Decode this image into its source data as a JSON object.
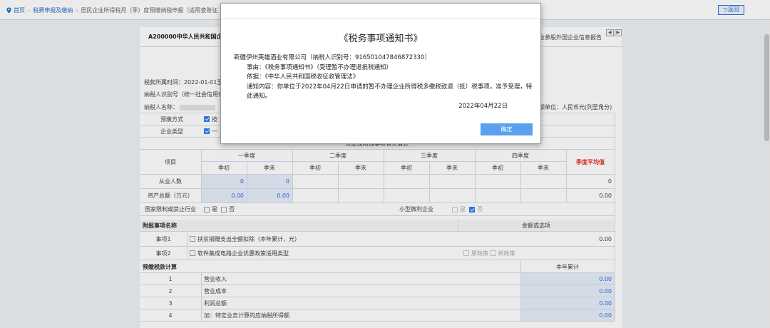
{
  "breadcrumb": {
    "home": "首页",
    "level2": "税费申报及缴纳",
    "level3": "居民企业所得税月（季）度预缴纳税申报（适用查账征"
  },
  "back_label": "返回",
  "tabs": {
    "active": "A200000中华人民共和国企",
    "other": "业参股外国企业信息报告"
  },
  "form": {
    "period": "税款所属时间：2022-01-01至",
    "taxpayer_id_label": "纳税人识别号（统一社会信用代",
    "taxpayer_name_label": "纳税人名称：",
    "amount_unit": "额单位：人民币元(列至角分)",
    "prepay_method_label": "预缴方式",
    "prepay_method_value": "按",
    "enterprise_type_label": "企业类型",
    "enterprise_type_value": "一",
    "section_title": "优惠及附报事项有关信息",
    "item_header": "项目",
    "quarters": [
      "一季度",
      "二季度",
      "三季度",
      "四季度"
    ],
    "q_start": "季初",
    "q_end": "季末",
    "avg_header": "季度平均值",
    "rows": [
      {
        "label": "从业人数",
        "q1_start": "0",
        "q1_end": "0",
        "avg": "0"
      },
      {
        "label": "资产总额（万元）",
        "q1_start": "0.00",
        "q1_end": "0.00",
        "avg": "0.00"
      }
    ],
    "restricted_label": "国家限制或禁止行业",
    "yes": "是",
    "no": "否",
    "small_micro_label": "小型微利企业",
    "attached_header": "附报事项名称",
    "amount_header": "金额或选项",
    "item1_label": "事项1",
    "item1_desc": "扶贫捐赠支出全额扣除（本年累计，元）",
    "item1_value": "0.00",
    "item2_label": "事项2",
    "item2_desc": "软件集成电路企业优惠政策适用类型",
    "old_policy": "原政策",
    "new_policy": "新政策",
    "calc_header": "预缴税款计算",
    "ytd_header": "本年累计",
    "calc_rows": [
      {
        "no": "1",
        "label": "营业收入",
        "value": "0.00"
      },
      {
        "no": "2",
        "label": "营业成本",
        "value": "0.00"
      },
      {
        "no": "3",
        "label": "利润总额",
        "value": "0.00"
      },
      {
        "no": "4",
        "label": "加：特定业务计算的应纳税所得额",
        "value": "0.00"
      }
    ]
  },
  "modal": {
    "title": "《税务事项通知书》",
    "line1": "新疆伊州英雄酒业有限公司（纳税人识别号：916501047846872330）",
    "line2": "事由：《税务事项通知书》（受理暂不办理退抵税通知）",
    "line3": "依据：《中华人民共和国税收征收管理法》",
    "line4": "通知内容：你单位于2022年04月22日申请的暂不办理企业所得税多缴税款退（抵）税事项，准予受理，特此通知。",
    "date": "2022年04月22日",
    "ok_label": "确定"
  },
  "colors": {
    "accent": "#2f7ef5",
    "link": "#1d6fbf",
    "ok_button": "#5aa0ef",
    "avg_red": "#e5322d"
  }
}
